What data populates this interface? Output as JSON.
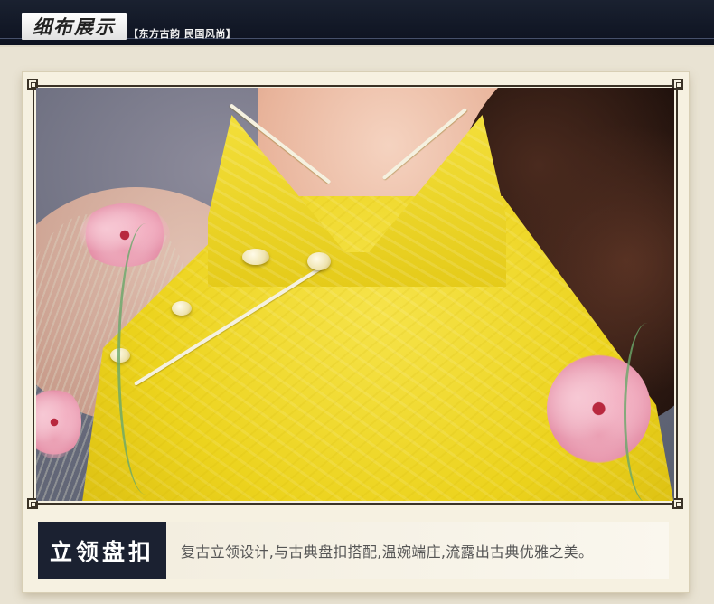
{
  "header": {
    "title": "细布展示",
    "subtitle": "【东方古韵 民国风尚】"
  },
  "caption": {
    "label": "立领盘扣",
    "text": "复古立领设计,与古典盘扣搭配,温婉端庄,流露出古典优雅之美。"
  },
  "colors": {
    "header_bg": "#0d1220",
    "panel_bg": "#f6f1e1",
    "frame": "#3a3226",
    "label_bg": "#1b2131",
    "dress_yellow": "#ecd31d"
  }
}
